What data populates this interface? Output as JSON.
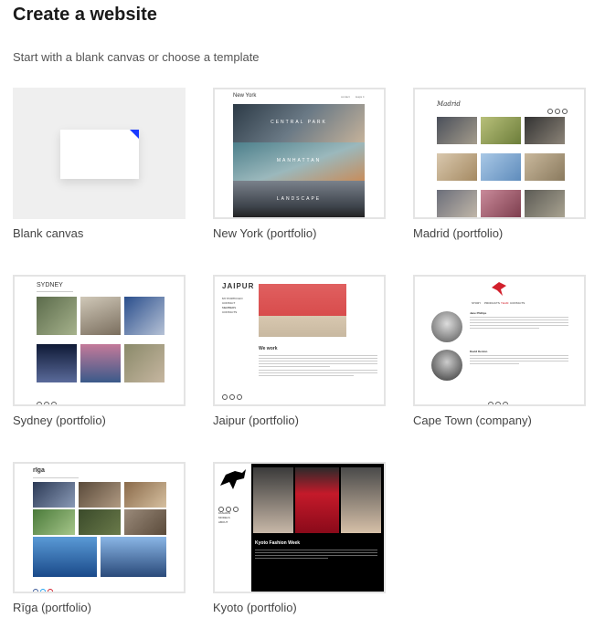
{
  "page": {
    "title": "Create a website",
    "subtitle": "Start with a blank canvas or choose a template"
  },
  "templates": [
    {
      "label": "Blank canvas"
    },
    {
      "label": "New York (portfolio)",
      "logo": "New York",
      "nav": [
        "contact",
        "leaps it"
      ],
      "banners": [
        "CENTRAL PARK",
        "MANHATTAN",
        "LANDSCAPE"
      ]
    },
    {
      "label": "Madrid (portfolio)",
      "logo": "Madrid"
    },
    {
      "label": "Sydney (portfolio)",
      "logo": "SYDNEY"
    },
    {
      "label": "Jaipur (portfolio)",
      "logo": "JAIPUR",
      "heading": "We work",
      "nav": [
        "MY PORTFOLIO",
        "CONTACT",
        "MEMBERS",
        "CONTACTS"
      ]
    },
    {
      "label": "Cape Town (company)",
      "nav": [
        "STORY",
        "PRODUCTS",
        "TEAM",
        "CONTACTS"
      ],
      "people": [
        "Jane Phillips",
        "David Denton"
      ]
    },
    {
      "label": "Rīga (portfolio)",
      "logo": "rīga"
    },
    {
      "label": "Kyoto (portfolio)",
      "heading": "Kyoto Fashion Week",
      "nav": [
        "FASHION",
        "MODELS",
        "ABOUT"
      ]
    }
  ],
  "colors": {
    "accent_blue": "#1a3aff",
    "cape_red": "#d2202c",
    "border": "#e4e4e4"
  }
}
